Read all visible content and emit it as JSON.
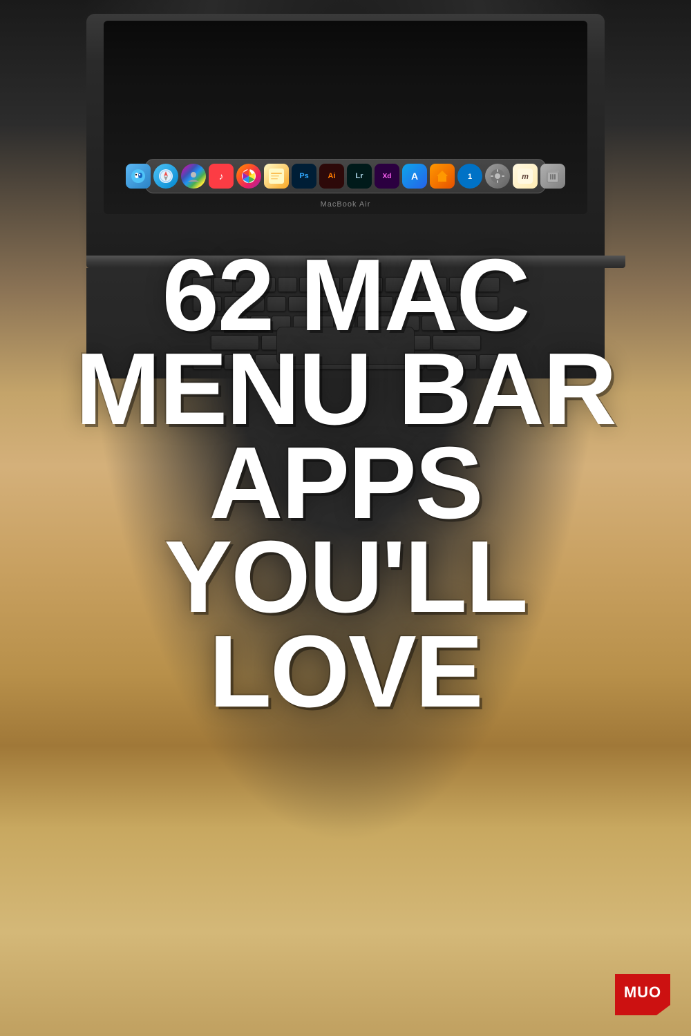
{
  "background": {
    "description": "MacBook Air on wooden desk"
  },
  "laptop": {
    "model_label": "MacBook Air",
    "dock_icons": [
      {
        "id": "finder",
        "label": "Finder",
        "css_class": "finder"
      },
      {
        "id": "safari",
        "label": "Safari",
        "css_class": "safari"
      },
      {
        "id": "photos2",
        "label": "Contacts",
        "css_class": "photos2"
      },
      {
        "id": "music",
        "label": "Music",
        "css_class": "music"
      },
      {
        "id": "photos",
        "label": "Photos",
        "css_class": "photos"
      },
      {
        "id": "notes",
        "label": "Notes",
        "css_class": "notes"
      },
      {
        "id": "ps",
        "label": "Ps",
        "css_class": "ps"
      },
      {
        "id": "ai",
        "label": "Ai",
        "css_class": "ai"
      },
      {
        "id": "lr",
        "label": "Lr",
        "css_class": "lr"
      },
      {
        "id": "xd",
        "label": "Xd",
        "css_class": "xd"
      },
      {
        "id": "appstore",
        "label": "App Store",
        "css_class": "appstore"
      },
      {
        "id": "home",
        "label": "Home",
        "css_class": "home"
      },
      {
        "id": "onepass",
        "label": "1Password",
        "css_class": "onepass"
      },
      {
        "id": "system",
        "label": "System Prefs",
        "css_class": "system"
      },
      {
        "id": "mulleder",
        "label": "Mulleder",
        "css_class": "mulleder"
      },
      {
        "id": "trash",
        "label": "Trash",
        "css_class": "trash"
      }
    ]
  },
  "headline": {
    "line1": "62 MAC",
    "line2": "MENU BAR",
    "line3": "APPS YOU'LL",
    "line4": "LOVE"
  },
  "logo": {
    "text": "MUO",
    "brand_color": "#cc1111"
  }
}
